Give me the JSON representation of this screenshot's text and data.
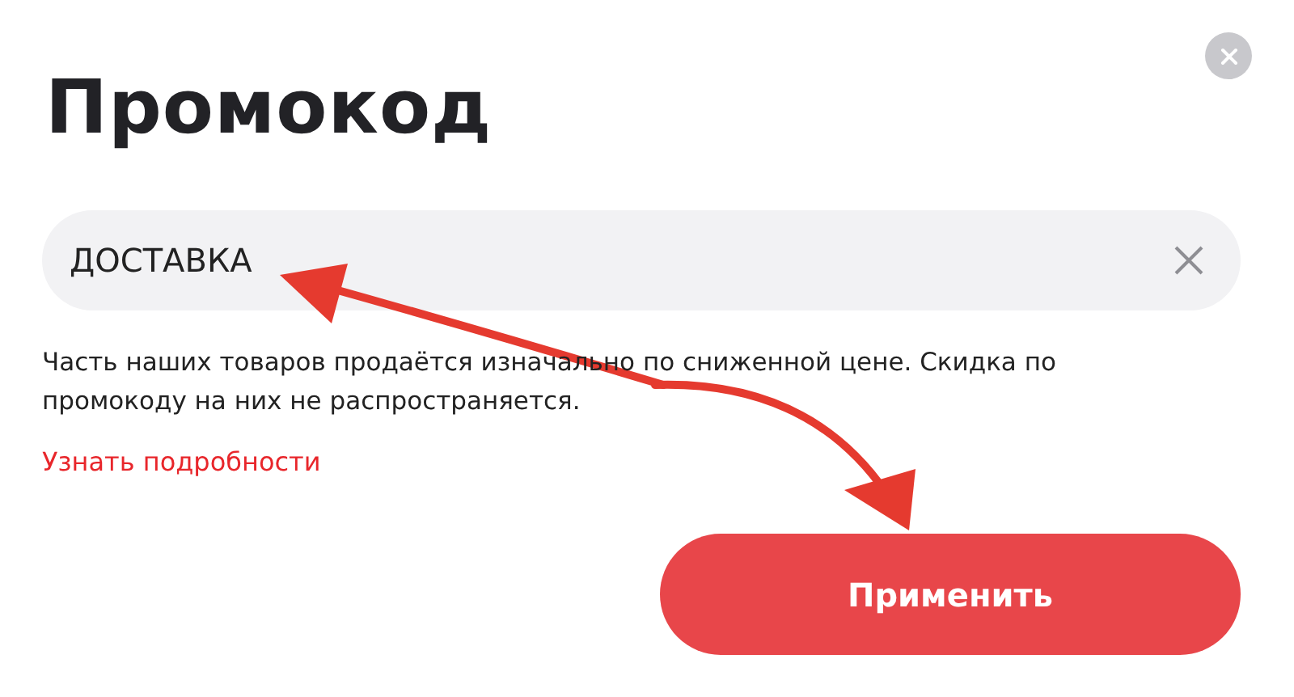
{
  "title": "Промокод",
  "promo_field": {
    "value": "ДОСТАВКА"
  },
  "note": "Часть наших товаров продаётся изначально по сниженной цене. Скидка по промокоду на них не распространяется.",
  "details_link": "Узнать подробности",
  "apply_button": "Применить"
}
